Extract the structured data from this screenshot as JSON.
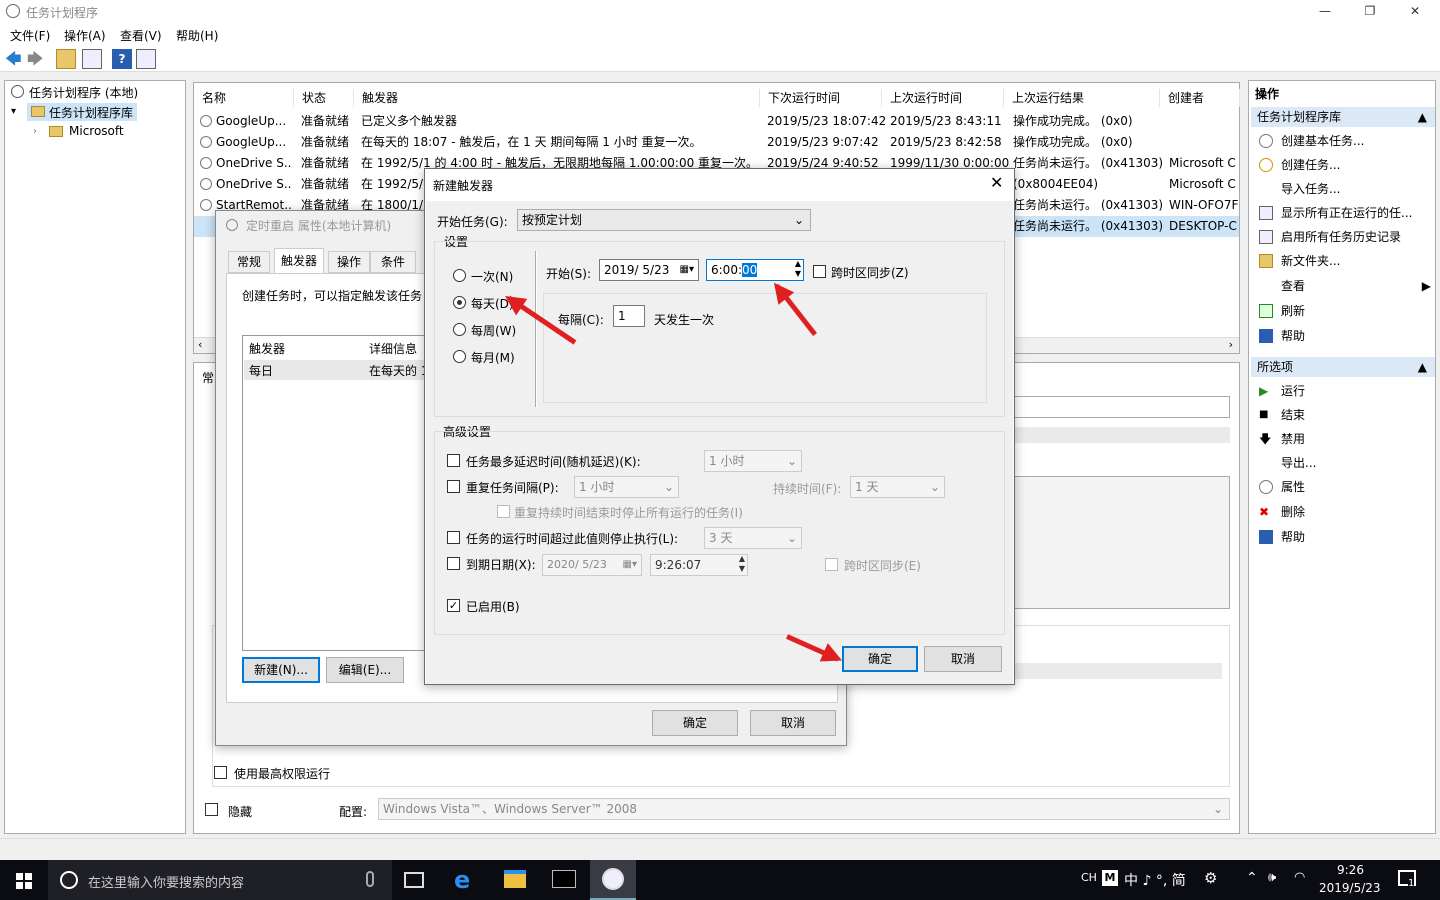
{
  "window": {
    "title": "任务计划程序"
  },
  "menu": [
    "文件(F)",
    "操作(A)",
    "查看(V)",
    "帮助(H)"
  ],
  "tree": {
    "root": "任务计划程序 (本地)",
    "library": "任务计划程序库",
    "child": "Microsoft"
  },
  "table": {
    "columns": [
      "名称",
      "状态",
      "触发器",
      "下次运行时间",
      "上次运行时间",
      "上次运行结果",
      "创建者"
    ],
    "rows": [
      {
        "name": "GoogleUp...",
        "status": "准备就绪",
        "trigger": "已定义多个触发器",
        "next": "2019/5/23 18:07:42",
        "last": "2019/5/23 8:43:11",
        "result": "操作成功完成。 (0x0)",
        "author": ""
      },
      {
        "name": "GoogleUp...",
        "status": "准备就绪",
        "trigger": "在每天的 18:07 - 触发后，在 1 天 期间每隔 1 小时 重复一次。",
        "next": "2019/5/23 9:07:42",
        "last": "2019/5/23 8:42:58",
        "result": "操作成功完成。 (0x0)",
        "author": ""
      },
      {
        "name": "OneDrive S...",
        "status": "准备就绪",
        "trigger": "在 1992/5/1 的 4:00 时 - 触发后，无限期地每隔 1.00:00:00 重复一次。",
        "next": "2019/5/24 9:40:52",
        "last": "1999/11/30 0:00:00",
        "result": "任务尚未运行。 (0x41303)",
        "author": "Microsoft C"
      },
      {
        "name": "OneDrive S...",
        "status": "准备就绪",
        "trigger": "在 1992/5/",
        "next": "",
        "last": "",
        "result": "(0x8004EE04)",
        "author": "Microsoft C"
      },
      {
        "name": "StartRemot...",
        "status": "准备就绪",
        "trigger": "在 1800/1/",
        "next": "",
        "last": "",
        "result": "任务尚未运行。 (0x41303)",
        "author": "WIN-OFO7F"
      },
      {
        "name": "",
        "status": "",
        "trigger": "",
        "next": "",
        "last": "",
        "result": "任务尚未运行。 (0x41303)",
        "author": "DESKTOP-C"
      }
    ]
  },
  "actions": {
    "group1": "任务计划程序库",
    "items1": [
      "创建基本任务...",
      "创建任务...",
      "导入任务...",
      "显示所有正在运行的任...",
      "启用所有任务历史记录",
      "新文件夹...",
      "查看",
      "刷新",
      "帮助"
    ],
    "group2": "所选项",
    "items2": [
      "运行",
      "结束",
      "禁用",
      "导出...",
      "属性",
      "删除",
      "帮助"
    ]
  },
  "props": {
    "title": "定时重启 属性(本地计算机)",
    "tabs": [
      "常规",
      "触发器",
      "操作",
      "条件"
    ],
    "desc": "创建任务时，可以指定触发该任务",
    "list_cols": [
      "触发器",
      "详细信息"
    ],
    "list_row": [
      "每日",
      "在每天的 1"
    ],
    "btn_new": "新建(N)...",
    "btn_edit": "编辑(E)...",
    "ok": "确定",
    "cancel": "取消"
  },
  "bg_general": {
    "tab": "常",
    "highest": "使用最高权限运行",
    "hidden": "隐藏",
    "config_label": "配置:",
    "config_value": "Windows Vista™、Windows Server™ 2008"
  },
  "trigger": {
    "title": "新建触发器",
    "begin_label": "开始任务(G):",
    "begin_value": "按预定计划",
    "settings": "设置",
    "radios": [
      "一次(N)",
      "每天(D)",
      "每周(W)",
      "每月(M)"
    ],
    "start_label": "开始(S):",
    "date": "2019/ 5/23",
    "time_a": "6:00:",
    "time_b": "00",
    "sync": "跨时区同步(Z)",
    "interval_label": "每隔(C):",
    "interval_value": "1",
    "interval_unit": "天发生一次",
    "advanced": "高级设置",
    "delay": "任务最多延迟时间(随机延迟)(K):",
    "delay_val": "1 小时",
    "repeat": "重复任务间隔(P):",
    "repeat_val": "1 小时",
    "duration": "持续时间(F):",
    "duration_val": "1 天",
    "stop_repeat": "重复持续时间结束时停止所有运行的任务(I)",
    "stop_long": "任务的运行时间超过此值则停止执行(L):",
    "stop_long_val": "3 天",
    "expire": "到期日期(X):",
    "expire_date": "2020/ 5/23",
    "expire_time": "9:26:07",
    "expire_sync": "跨时区同步(E)",
    "enabled": "已启用(B)",
    "ok": "确定",
    "cancel": "取消"
  },
  "taskbar": {
    "search": "在这里输入你要搜索的内容",
    "time": "9:26",
    "date": "2019/5/23",
    "ime": "CH",
    "tray": "中 ♪ °, 简",
    "notify": "1"
  },
  "colors": {
    "accent": "#0078d7",
    "arrow": "#e02020",
    "taskbar": "#0b0b12"
  }
}
